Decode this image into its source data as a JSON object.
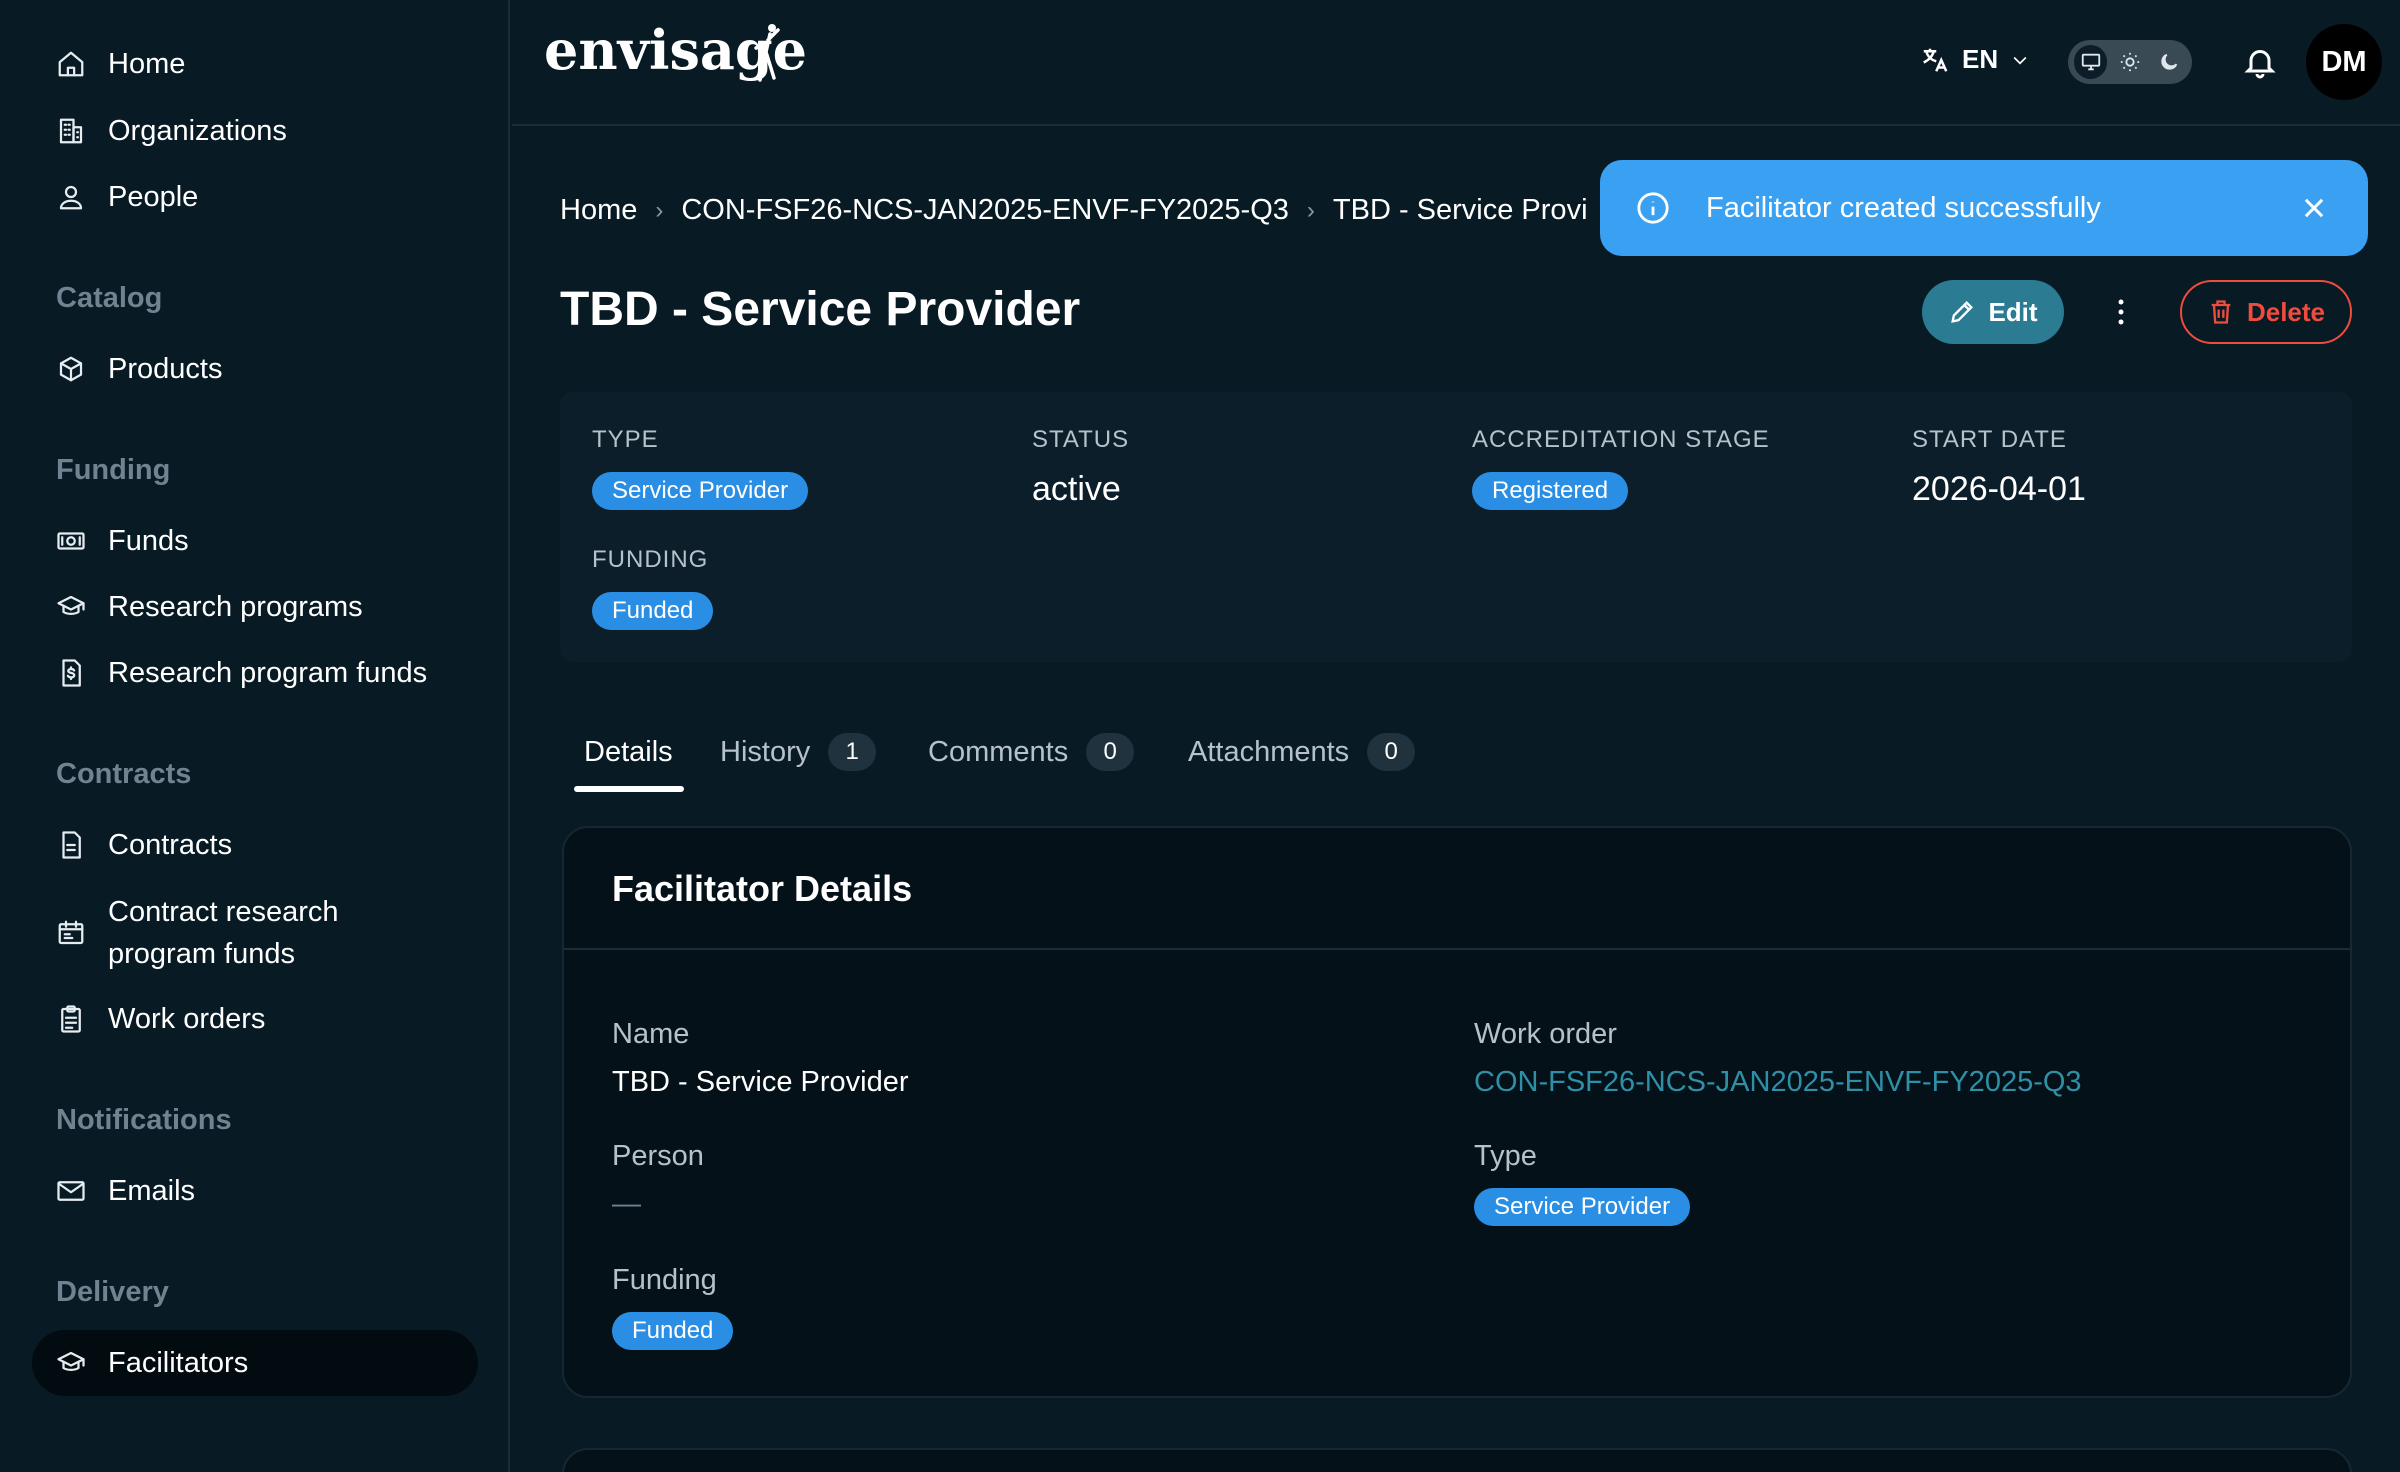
{
  "sidebar": {
    "items_top": [
      {
        "label": "Home",
        "icon": "home-icon"
      },
      {
        "label": "Organizations",
        "icon": "building-icon"
      },
      {
        "label": "People",
        "icon": "person-icon"
      }
    ],
    "sections": {
      "catalog": "Catalog",
      "funding": "Funding",
      "contracts": "Contracts",
      "notifications": "Notifications",
      "delivery": "Delivery"
    },
    "catalog_items": [
      {
        "label": "Products",
        "icon": "box-icon"
      }
    ],
    "funding_items": [
      {
        "label": "Funds",
        "icon": "money-icon"
      },
      {
        "label": "Research programs",
        "icon": "graduation-cap-icon"
      },
      {
        "label": "Research program funds",
        "icon": "dollar-document-icon"
      }
    ],
    "contracts_items": [
      {
        "label": "Contracts",
        "icon": "document-icon"
      },
      {
        "label": "Contract research program funds",
        "icon": "calendar-money-icon"
      },
      {
        "label": "Work orders",
        "icon": "clipboard-icon"
      }
    ],
    "notifications_items": [
      {
        "label": "Emails",
        "icon": "mail-icon"
      }
    ],
    "delivery_items": [
      {
        "label": "Facilitators",
        "icon": "graduation-cap-icon",
        "active": true
      }
    ]
  },
  "topbar": {
    "logo": "envisage",
    "language": "EN"
  },
  "user": {
    "initials": "DM"
  },
  "breadcrumb": [
    "Home",
    "CON-FSF26-NCS-JAN2025-ENVF-FY2025-Q3",
    "TBD - Service Provi"
  ],
  "toast": {
    "message": "Facilitator created successfully"
  },
  "page": {
    "title": "TBD - Service Provider",
    "edit_label": "Edit",
    "delete_label": "Delete"
  },
  "summary": {
    "type_label": "TYPE",
    "type_value": "Service Provider",
    "status_label": "STATUS",
    "status_value": "active",
    "accreditation_label": "ACCREDITATION STAGE",
    "accreditation_value": "Registered",
    "start_label": "START DATE",
    "start_value": "2026-04-01",
    "funding_label": "FUNDING",
    "funding_value": "Funded"
  },
  "tabs": [
    {
      "label": "Details",
      "count": null,
      "active": true
    },
    {
      "label": "History",
      "count": "1"
    },
    {
      "label": "Comments",
      "count": "0"
    },
    {
      "label": "Attachments",
      "count": "0"
    }
  ],
  "details": {
    "title": "Facilitator Details",
    "name_label": "Name",
    "name_value": "TBD - Service Provider",
    "work_order_label": "Work order",
    "work_order_value": "CON-FSF26-NCS-JAN2025-ENVF-FY2025-Q3",
    "person_label": "Person",
    "person_value": "—",
    "type_label": "Type",
    "type_value": "Service Provider",
    "funding_label": "Funding",
    "funding_value": "Funded"
  },
  "colors": {
    "background": "#081a24",
    "accent": "#2a8fe4",
    "toast": "#3aa0f2",
    "edit": "#2b7b93",
    "danger": "#ef4c3e",
    "link": "#2f8fa6"
  }
}
